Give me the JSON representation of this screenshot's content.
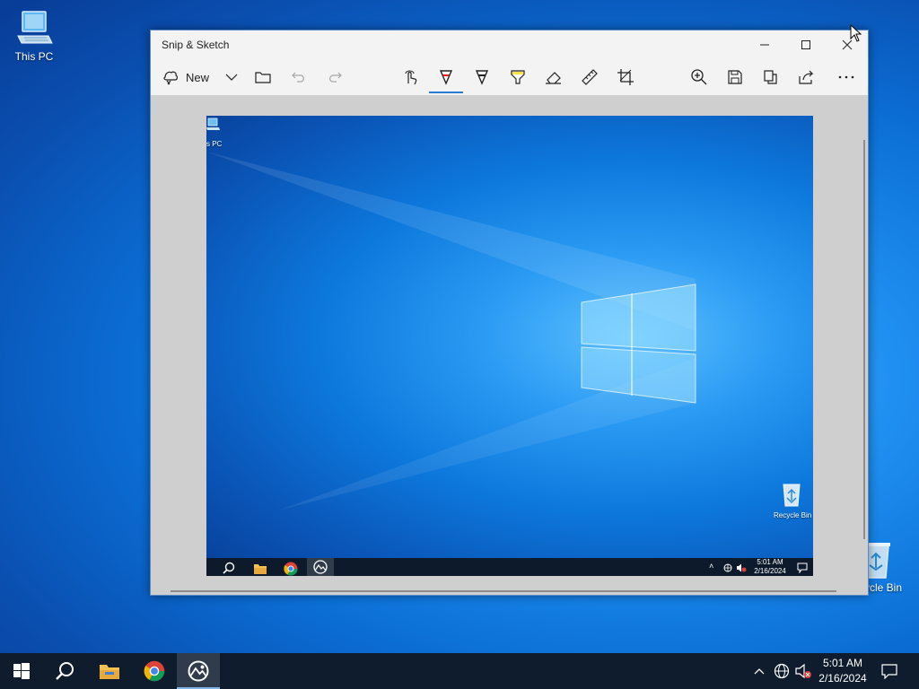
{
  "desktop": {
    "icons": [
      {
        "label": "This PC",
        "icon": "this-pc-icon"
      },
      {
        "label": "cycle Bin",
        "icon": "recycle-bin-icon"
      }
    ]
  },
  "window": {
    "title": "Snip & Sketch",
    "controls": {
      "minimize": "minimize-icon",
      "maximize": "maximize-icon",
      "close": "close-icon"
    },
    "toolbar": {
      "new_label": "New",
      "tools": [
        "touch-writing-icon",
        "ballpoint-pen-icon",
        "pencil-icon",
        "highlighter-icon",
        "eraser-icon",
        "ruler-icon",
        "crop-icon",
        "zoom-icon",
        "save-icon",
        "copy-icon",
        "share-icon",
        "more-icon"
      ],
      "selected_tool": "ballpoint-pen",
      "accent_color": "#2b7bd5"
    },
    "capture": {
      "desktop_labels": {
        "this_pc_partial": "s PC",
        "recycle_bin": "Recycle Bin"
      },
      "clock": {
        "time": "5:01 AM",
        "date": "2/16/2024"
      }
    }
  },
  "taskbar": {
    "pinned": [
      "windows-start-icon",
      "search-icon",
      "file-explorer-icon",
      "chrome-icon",
      "snip-sketch-icon"
    ],
    "active_app": "Snip & Sketch",
    "tray": [
      "chevron-up-icon",
      "network-icon",
      "volume-muted-icon"
    ],
    "clock": {
      "time": "5:01 AM",
      "date": "2/16/2024"
    },
    "notification": "action-center-icon"
  }
}
